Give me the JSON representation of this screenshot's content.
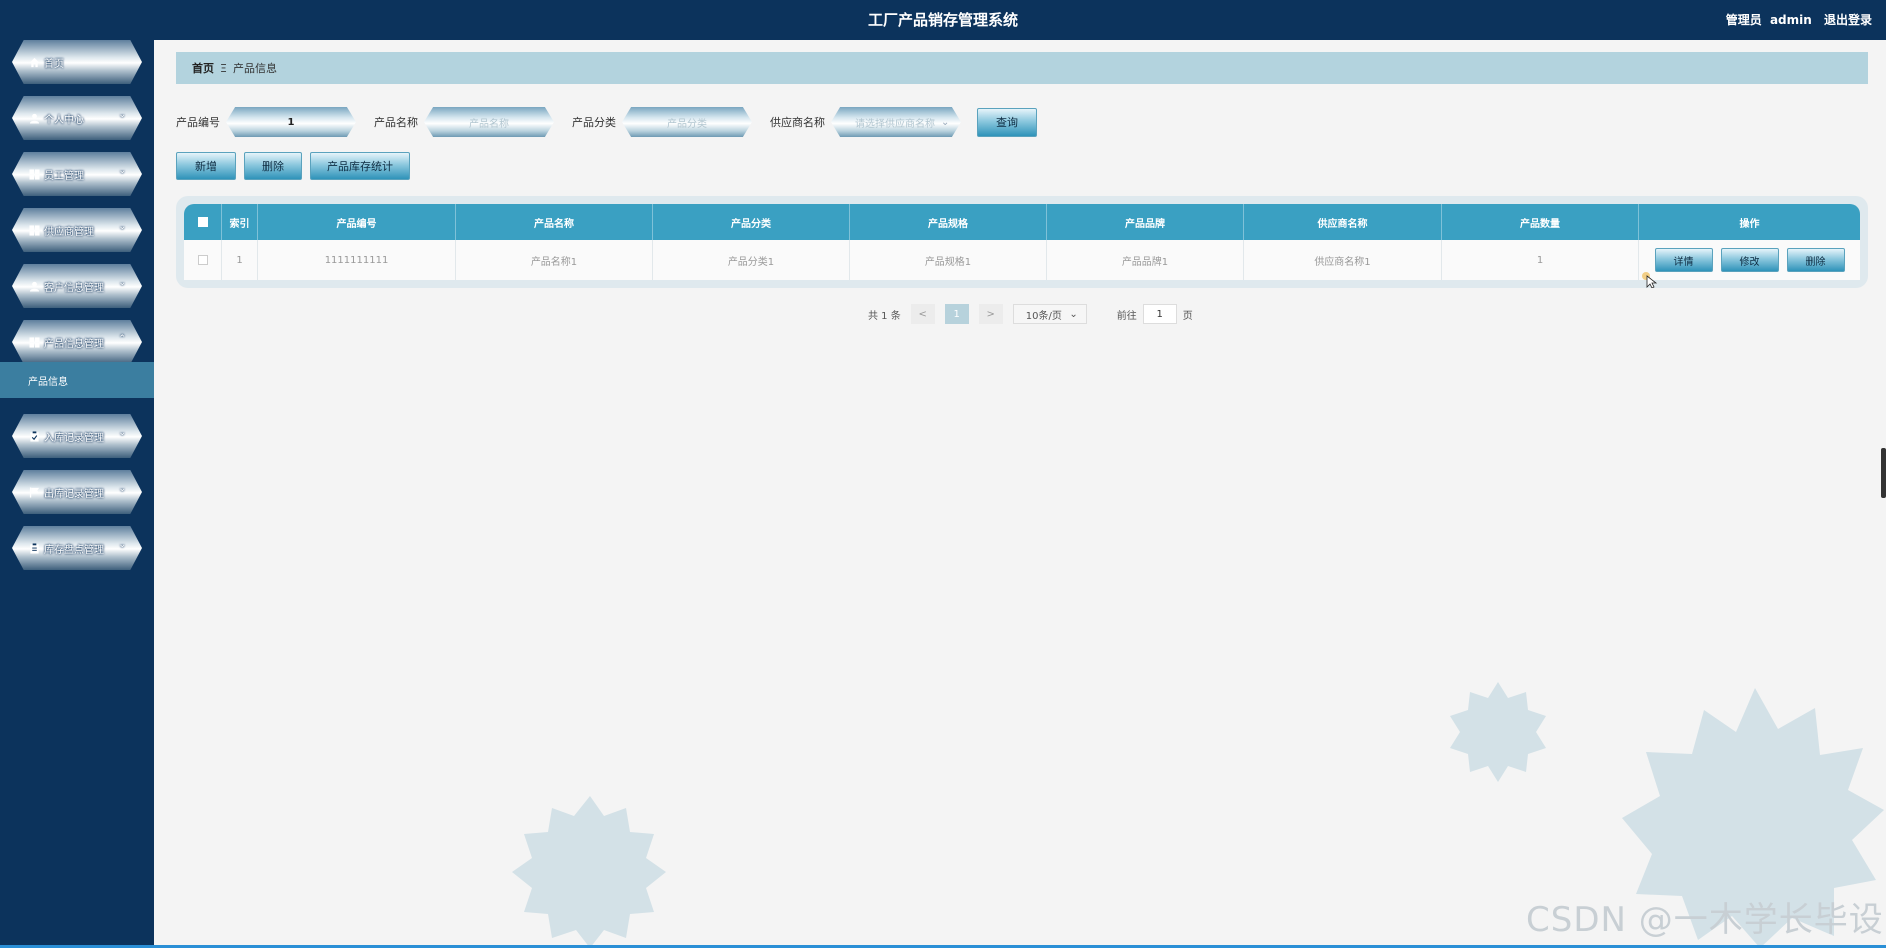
{
  "header": {
    "title": "工厂产品销存管理系统",
    "role": "管理员",
    "username": "admin",
    "logout": "退出登录"
  },
  "sidebar": {
    "items": [
      {
        "label": "首页",
        "icon": "home-icon",
        "has_chevron": false
      },
      {
        "label": "个人中心",
        "icon": "user-icon",
        "has_chevron": true
      },
      {
        "label": "员工管理",
        "icon": "grid-icon",
        "has_chevron": true
      },
      {
        "label": "供应商管理",
        "icon": "grid-icon",
        "has_chevron": true
      },
      {
        "label": "客户信息管理",
        "icon": "user-icon",
        "has_chevron": true
      },
      {
        "label": "产品信息管理",
        "icon": "grid-icon",
        "has_chevron": true,
        "expanded": true
      },
      {
        "label": "入库记录管理",
        "icon": "clipboard-icon",
        "has_chevron": true
      },
      {
        "label": "出库记录管理",
        "icon": "flag-icon",
        "has_chevron": true
      },
      {
        "label": "库存盘点管理",
        "icon": "clipboard-icon",
        "has_chevron": true
      }
    ],
    "submenu": {
      "label": "产品信息"
    }
  },
  "breadcrumb": {
    "home": "首页",
    "separator": "Ξ",
    "current": "产品信息"
  },
  "search": {
    "code_label": "产品编号",
    "code_value": "1",
    "name_label": "产品名称",
    "name_placeholder": "产品名称",
    "category_label": "产品分类",
    "category_placeholder": "产品分类",
    "supplier_label": "供应商名称",
    "supplier_placeholder": "请选择供应商名称",
    "query_button": "查询"
  },
  "actions": {
    "add": "新增",
    "delete": "删除",
    "stats": "产品库存统计"
  },
  "table": {
    "headers": [
      "索引",
      "产品编号",
      "产品名称",
      "产品分类",
      "产品规格",
      "产品品牌",
      "供应商名称",
      "产品数量",
      "操作"
    ],
    "rows": [
      {
        "index": "1",
        "code": "1111111111",
        "name": "产品名称1",
        "category": "产品分类1",
        "spec": "产品规格1",
        "brand": "产品品牌1",
        "supplier": "供应商名称1",
        "quantity": "1"
      }
    ],
    "row_actions": {
      "detail": "详情",
      "edit": "修改",
      "delete": "删除"
    }
  },
  "pagination": {
    "total": "共 1 条",
    "prev": "<",
    "current": "1",
    "next": ">",
    "page_size": "10条/页",
    "goto_label": "前往",
    "goto_value": "1",
    "page_unit": "页"
  },
  "watermark": "CSDN @一木学长毕设",
  "colors": {
    "navy": "#0c335c",
    "accent": "#3aa0c2",
    "breadcrumb_bg": "#b3d3de",
    "submenu_bg": "#3b7ea0"
  }
}
